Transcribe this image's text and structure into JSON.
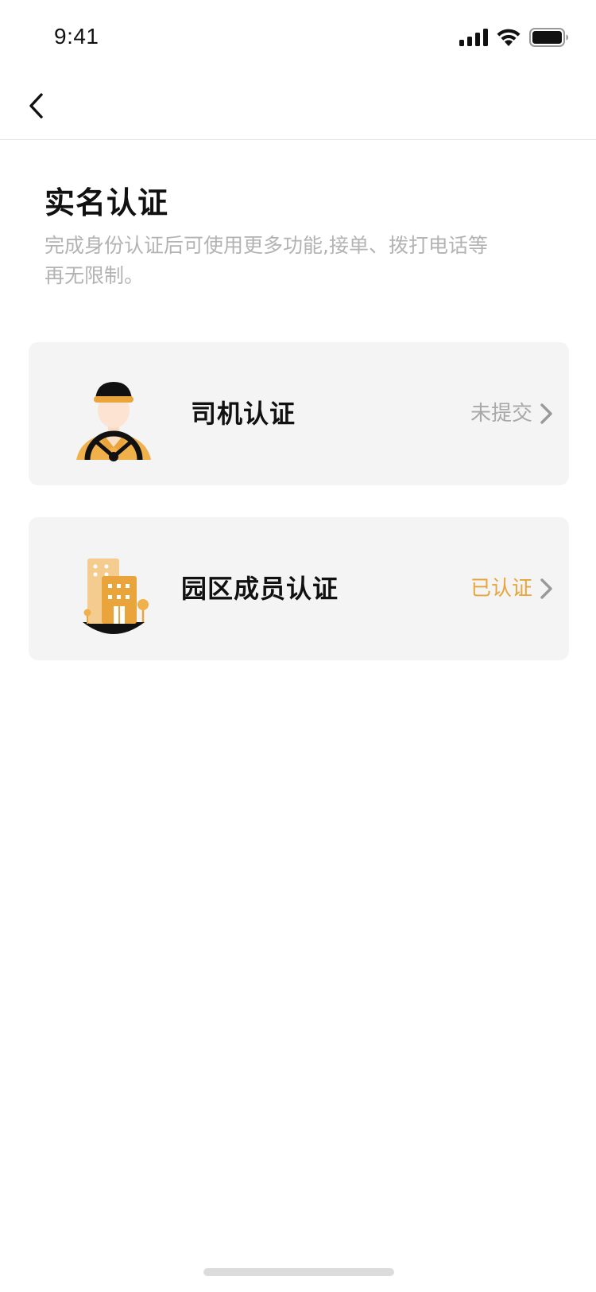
{
  "status_bar": {
    "time": "9:41",
    "icons": [
      "signal-icon",
      "wifi-icon",
      "battery-icon"
    ]
  },
  "nav": {
    "back_icon": "chevron-left-icon"
  },
  "header": {
    "title": "实名认证",
    "description": "完成身份认证后可使用更多功能,接单、拨打电话等再无限制。"
  },
  "cards": [
    {
      "label": "司机认证",
      "status": "未提交",
      "status_color": "#a8a8a8",
      "icon": "driver-icon"
    },
    {
      "label": "园区成员认证",
      "status": "已认证",
      "status_color": "#e9a53b",
      "icon": "building-icon"
    }
  ],
  "colors": {
    "accent": "#e9a53b",
    "card_bg": "#f4f4f4",
    "muted_text": "#b3b3b3"
  }
}
